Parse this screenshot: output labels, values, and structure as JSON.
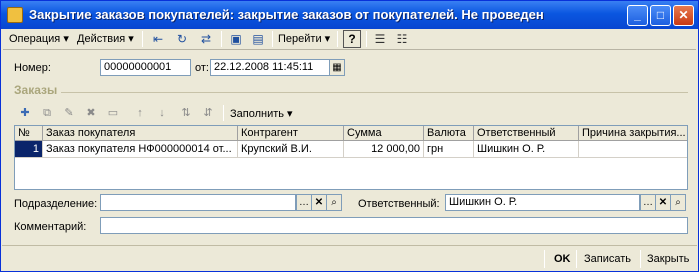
{
  "window": {
    "title": "Закрытие заказов покупателей: закрытие заказов от покупателей. Не проведен",
    "minimize": "_",
    "maximize": "□",
    "close": "✕"
  },
  "toolbar": {
    "operation": "Операция ▾",
    "actions": "Действия ▾",
    "goto": "Перейти ▾",
    "help": "?"
  },
  "header": {
    "number_label": "Номер:",
    "number_value": "00000000001",
    "date_label": "от:",
    "date_value": "22.12.2008 11:45:11"
  },
  "orders": {
    "section_title": "Заказы",
    "fill_label": "Заполнить ▾",
    "columns": [
      "№",
      "Заказ покупателя",
      "Контрагент",
      "Сумма",
      "Валюта",
      "Ответственный",
      "Причина закрытия..."
    ],
    "rows": [
      {
        "n": "1",
        "order": "Заказ покупателя НФ000000014 от...",
        "counterparty": "Крупский В.И.",
        "sum": "12 000,00",
        "currency": "грн",
        "responsible": "Шишкин О. Р.",
        "reason": ""
      }
    ]
  },
  "footer_fields": {
    "department_label": "Подразделение:",
    "department_value": "",
    "responsible_label": "Ответственный:",
    "responsible_value": "Шишкин О. Р.",
    "comment_label": "Комментарий:",
    "comment_value": ""
  },
  "buttons": {
    "ok": "OK",
    "save": "Записать",
    "close": "Закрыть"
  }
}
